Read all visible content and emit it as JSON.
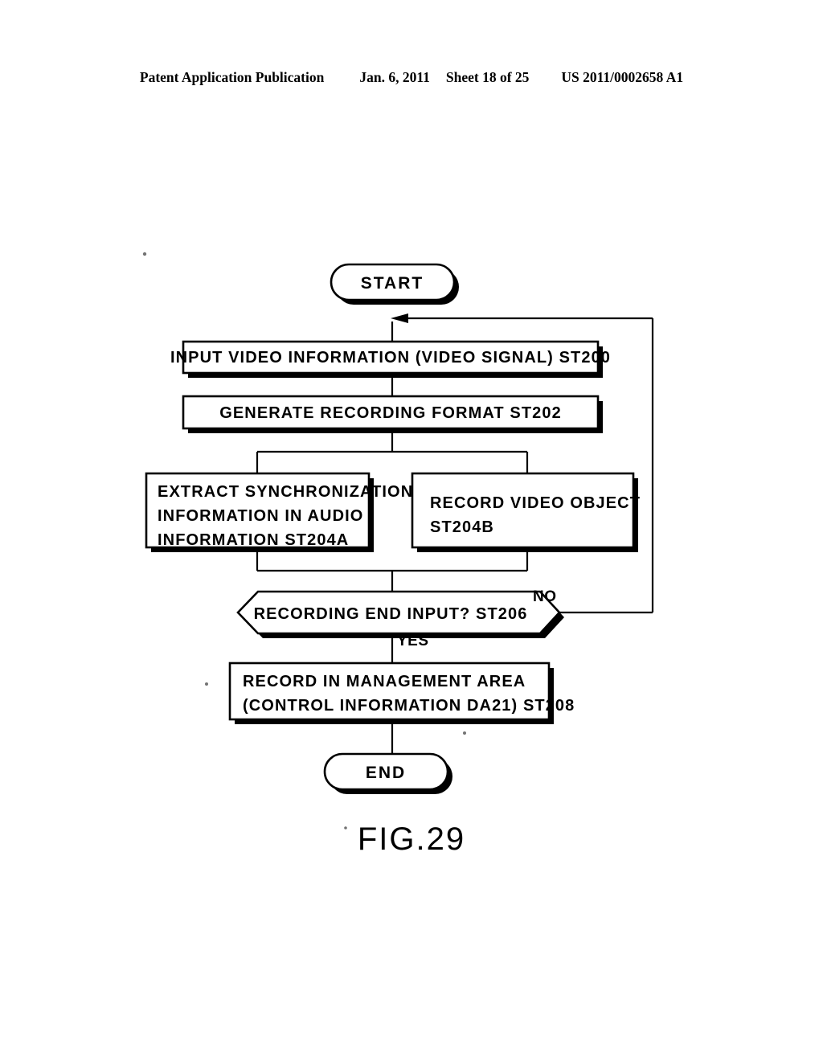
{
  "header": {
    "publication": "Patent Application Publication",
    "date": "Jan. 6, 2011",
    "sheet": "Sheet 18 of 25",
    "patent_number": "US 2011/0002658 A1"
  },
  "figure": {
    "caption": "FIG.29",
    "nodes": {
      "start": "START",
      "input_video": "INPUT VIDEO INFORMATION (VIDEO SIGNAL) ST200",
      "generate_format": "GENERATE RECORDING FORMAT ST202",
      "extract_sync_line1": "EXTRACT SYNCHRONIZATION",
      "extract_sync_line2": "INFORMATION IN AUDIO",
      "extract_sync_line3": "INFORMATION ST204A",
      "record_video_line1": "RECORD VIDEO OBJECT",
      "record_video_line2": "ST204B",
      "decision": "RECORDING END INPUT? ST206",
      "record_mgmt_line1": "RECORD IN MANAGEMENT AREA",
      "record_mgmt_line2": "(CONTROL INFORMATION DA21) ST208",
      "end": "END"
    },
    "edge_labels": {
      "no": "NO",
      "yes": "YES"
    }
  },
  "colors": {
    "ink": "#000000",
    "page": "#ffffff"
  }
}
